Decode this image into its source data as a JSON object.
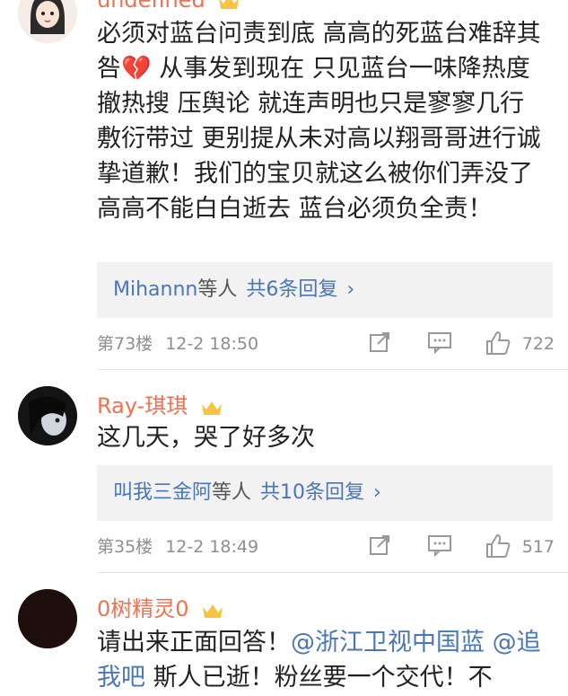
{
  "comments": [
    {
      "username": "undefined",
      "text": "必须对蓝台问责到底 高高的死蓝台难辞其咎💔 从事发到现在 只见蓝台一味降热度 撤热搜 压舆论 就连声明也只是寥寥几行 敷衍带过 更别提从未对高以翔哥哥进行诚挚道歉！我们的宝贝就这么被你们弄没了 高高不能白白逝去 蓝台必须负全责！",
      "reply_summary": {
        "users": "Mihannn",
        "etc": "等人",
        "count_text": "共6条回复"
      },
      "floor": "第73楼",
      "time": "12-2 18:50",
      "likes": "722"
    },
    {
      "username": "Ray-琪琪",
      "text": "这几天，哭了好多次",
      "reply_summary": {
        "users": "叫我三金阿",
        "etc": "等人",
        "count_text": "共10条回复"
      },
      "floor": "第35楼",
      "time": "12-2 18:49",
      "likes": "517"
    },
    {
      "username": "0树精灵0",
      "text_prefix": "请出来正面回答！",
      "mention1": "@浙江卫视中国蓝",
      "mention2": "@追我吧",
      "text_suffix": " 斯人已逝！粉丝要一个交代！不"
    }
  ],
  "icons": {
    "share": "share-icon",
    "comment": "comment-icon",
    "like": "thumbs-up-icon",
    "badge": "vip-crown-icon",
    "chevron": "chevron-right-icon"
  },
  "colors": {
    "username": "#eb7350",
    "link": "#4a76b8",
    "meta": "#8e8e8e",
    "reply_bg": "#f2f2f2"
  }
}
